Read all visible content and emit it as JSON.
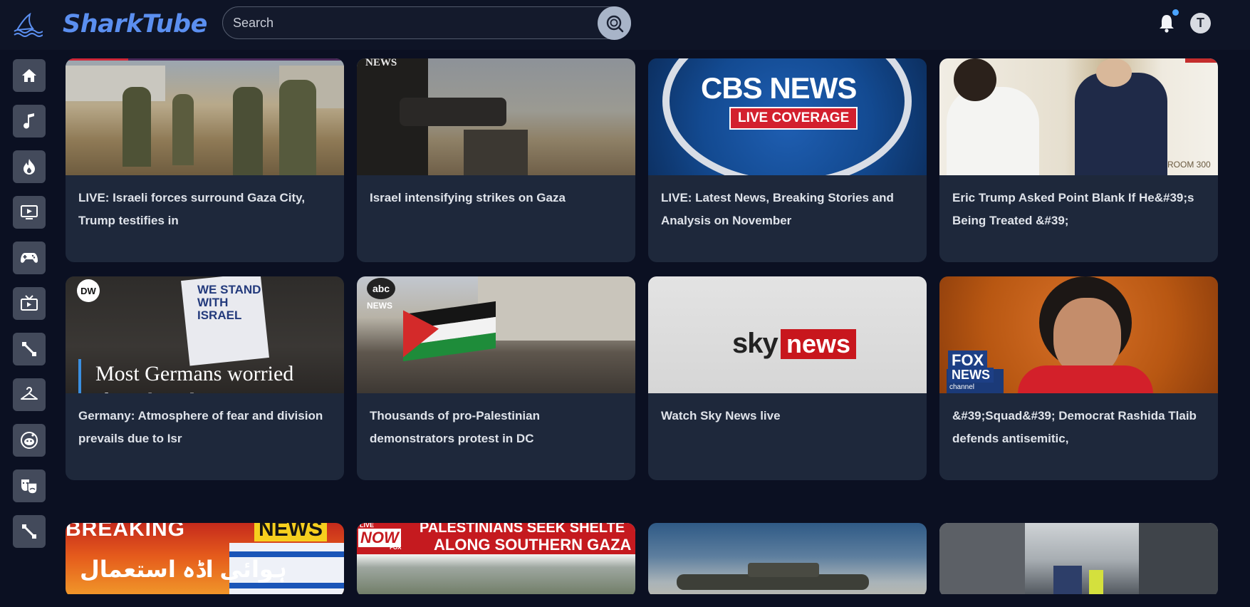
{
  "app": {
    "brand": "SharkTube",
    "search_placeholder": "Search",
    "avatar_initial": "T"
  },
  "sidebar": {
    "items": [
      {
        "icon": "home-icon"
      },
      {
        "icon": "music-icon"
      },
      {
        "icon": "fire-icon"
      },
      {
        "icon": "play-screen-icon"
      },
      {
        "icon": "gamepad-icon"
      },
      {
        "icon": "tv-icon"
      },
      {
        "icon": "sports-icon"
      },
      {
        "icon": "hanger-icon"
      },
      {
        "icon": "reddit-icon"
      },
      {
        "icon": "theater-masks-icon"
      },
      {
        "icon": "sports-icon"
      }
    ]
  },
  "videos": [
    {
      "title": "LIVE: Israeli forces surround Gaza City, Trump testifies in"
    },
    {
      "title": "Israel intensifying strikes on Gaza",
      "thumb_text": "NEWS"
    },
    {
      "title": "LIVE: Latest News, Breaking Stories and Analysis on November",
      "thumb_text": "CBS NEWS",
      "thumb_badge": "LIVE COVERAGE"
    },
    {
      "title": "Eric Trump Asked Point Blank If He&#39;s Being Treated &#39;",
      "thumb_text": "ROOM 300"
    },
    {
      "title": "Germany: Atmosphere of fear and division prevails due to Isr",
      "thumb_text": "Most Germans worried about hostilities",
      "thumb_logo": "DW",
      "thumb_sign": "WE STAND WITH ISRAEL"
    },
    {
      "title": "Thousands of pro-Palestinian demonstrators protest in DC",
      "thumb_logo": "abc",
      "thumb_text": "NEWS"
    },
    {
      "title": "Watch Sky News live",
      "thumb_text_1": "sky",
      "thumb_text_2": "news"
    },
    {
      "title": "&#39;Squad&#39; Democrat Rashida Tlaib defends antisemitic,",
      "thumb_logo_1": "FOX",
      "thumb_logo_2": "NEWS",
      "thumb_logo_3": "channel"
    },
    {
      "thumb_text_1": "BREAKING",
      "thumb_text_2": "NEWS",
      "thumb_text_3": "ہوائی اڈہ استعمال"
    },
    {
      "thumb_badge_1": "LIVE",
      "thumb_badge_2": "NOW",
      "thumb_badge_3": "FOX",
      "thumb_text_1": "PALESTINIANS SEEK SHELTE",
      "thumb_text_2": "ALONG SOUTHERN GAZA"
    },
    {},
    {}
  ],
  "colors": {
    "background": "#0b1022",
    "topbar": "#0e1426",
    "card": "#1e283b",
    "brand": "#5b8ff0",
    "sidebar_button": "#434a5b",
    "notification_dot": "#4aa3ff"
  }
}
